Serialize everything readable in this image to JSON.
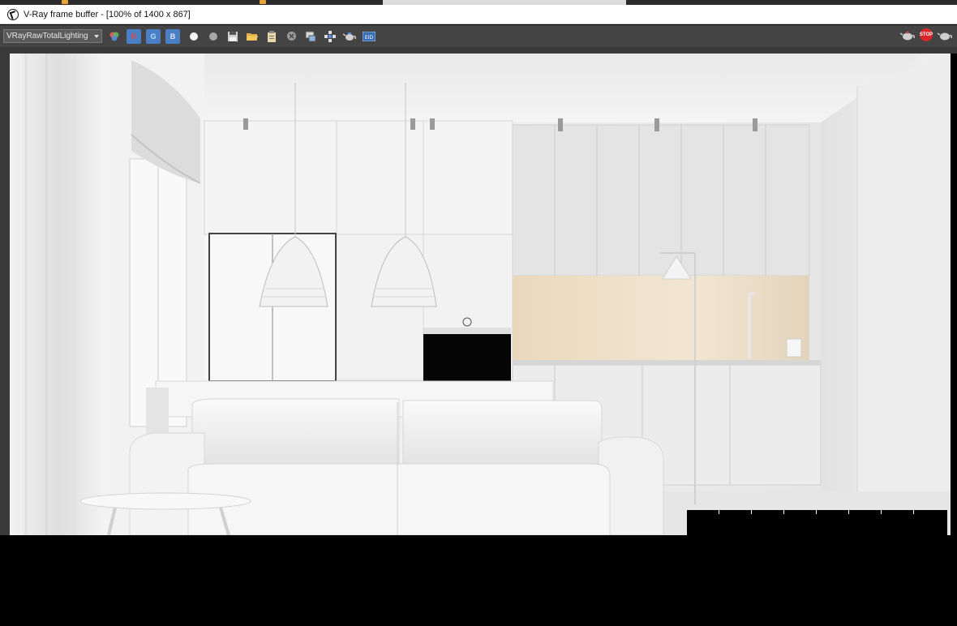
{
  "window": {
    "title": "V-Ray frame buffer - [100% of 1400 x 867]"
  },
  "toolbar": {
    "channel": "VRayRawTotalLighting",
    "buttons": [
      {
        "name": "color-channels-icon",
        "label": ""
      },
      {
        "name": "red-channel-button",
        "label": "R",
        "color": "#d84a4a"
      },
      {
        "name": "green-channel-button",
        "label": "G",
        "color": "#4a8fd8"
      },
      {
        "name": "blue-channel-button",
        "label": "B",
        "color": "#4a8fd8"
      },
      {
        "name": "white-circle-icon",
        "label": ""
      },
      {
        "name": "gray-circle-icon",
        "label": ""
      },
      {
        "name": "save-image-icon",
        "label": ""
      },
      {
        "name": "open-folder-icon",
        "label": ""
      },
      {
        "name": "clipboard-icon",
        "label": ""
      },
      {
        "name": "clear-image-icon",
        "label": ""
      },
      {
        "name": "track-mouse-icon",
        "label": ""
      },
      {
        "name": "region-render-icon",
        "label": ""
      },
      {
        "name": "render-teapot-icon",
        "label": ""
      },
      {
        "name": "vfb-history-icon",
        "label": ""
      }
    ],
    "right_buttons": [
      {
        "name": "render-icon"
      },
      {
        "name": "stop-button",
        "label": "STOP"
      },
      {
        "name": "interactive-render-icon"
      }
    ]
  },
  "colors": {
    "toolbar_bg": "#444444",
    "viewport_bg": "#3a3a3a",
    "channel_red": "#d84a4a",
    "channel_blue": "#4a8fd8",
    "stop_red": "#d8262a"
  }
}
